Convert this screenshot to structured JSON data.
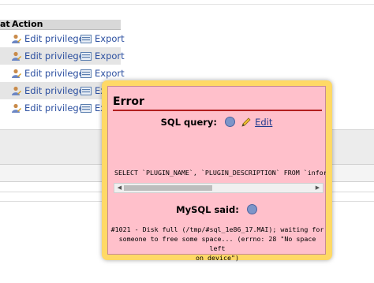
{
  "table": {
    "header_prefix": "at",
    "header_action": "Action",
    "rows": [
      {
        "edit": "Edit privileges",
        "export": "Export"
      },
      {
        "edit": "Edit privileges",
        "export": "Export"
      },
      {
        "edit": "Edit privileges",
        "export": "Export"
      },
      {
        "edit": "Edit privileges",
        "export": "Ex"
      },
      {
        "edit": "Edit privileges",
        "export": "Ex"
      }
    ]
  },
  "dialog": {
    "title": "Error",
    "sql_query_label": "SQL query:",
    "edit_link": "Edit",
    "sql_code": "SELECT `PLUGIN_NAME`, `PLUGIN_DESCRIPTION` FROM `infor",
    "mysql_said_label": "MySQL said:",
    "error_line1": "#1021 - Disk full (/tmp/#sql_1e86_17.MAI); waiting for",
    "error_line2": "someone to free some space... (errno: 28 \"No space left",
    "error_line3": "on device\")"
  },
  "colors": {
    "dialog_border": "#ffd966",
    "dialog_bg": "#ffc0cb",
    "title_rule": "#b21f1f",
    "link": "#2b4fa0"
  },
  "icons": [
    "user-edit-icon",
    "export-icon",
    "help-icon",
    "pencil-icon",
    "scroll-left-icon",
    "scroll-right-icon"
  ]
}
